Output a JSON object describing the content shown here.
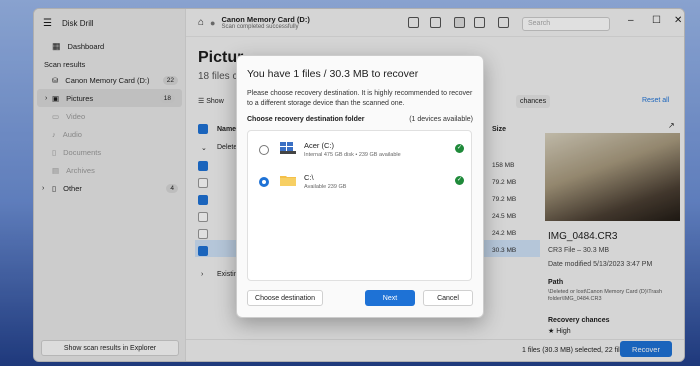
{
  "app": {
    "title": "Disk Drill"
  },
  "sidebar": {
    "dashboard": "Dashboard",
    "section": "Scan results",
    "items": [
      {
        "label": "Canon Memory Card (D:)",
        "count": "22"
      },
      {
        "label": "Pictures",
        "count": "18"
      },
      {
        "label": "Video",
        "count": ""
      },
      {
        "label": "Audio",
        "count": ""
      },
      {
        "label": "Documents",
        "count": ""
      },
      {
        "label": "Archives",
        "count": ""
      },
      {
        "label": "Other",
        "count": "4"
      }
    ],
    "footer_button": "Show scan results in Explorer"
  },
  "toolbar": {
    "title": "Canon Memory Card (D:)",
    "subtitle": "Scan completed successfully",
    "search_placeholder": "Search"
  },
  "main": {
    "page_title": "Pictur",
    "page_sub": "18 files c",
    "show_btn": "Show",
    "chances_btn": "chances",
    "reset_all": "Reset all",
    "col_name": "Name",
    "col_size": "Size",
    "group_deleted": "Delete",
    "group_existing": "Existin",
    "sizes": [
      "158 MB",
      "79.2 MB",
      "79.2 MB",
      "24.5 MB",
      "24.2 MB",
      "30.3 MB"
    ]
  },
  "preview": {
    "file_name": "IMG_0484.CR3",
    "file_type": "CR3 File – 30.3 MB",
    "modified": "Date modified 5/13/2023 3:47 PM",
    "path_label": "Path",
    "path_value": "\\Deleted or lost\\Canon Memory Card (D)\\Trash folder\\IMG_0484.CR3",
    "chances_label": "Recovery chances",
    "chances_value": "High"
  },
  "bottom": {
    "status": "1 files (30.3 MB) selected, 22 files total",
    "recover": "Recover"
  },
  "dialog": {
    "title": "You have 1 files / 30.3 MB to recover",
    "message": "Please choose recovery destination. It is highly recommended to recover to a different storage device than the scanned one.",
    "list_label": "Choose recovery destination folder",
    "devices_count": "(1 devices available)",
    "destinations": [
      {
        "name": "Acer (C:)",
        "detail": "Internal 475 GB disk • 239 GB available"
      },
      {
        "name": "C:\\",
        "detail": "Available 239 GB"
      }
    ],
    "choose_btn": "Choose destination",
    "next_btn": "Next",
    "cancel_btn": "Cancel"
  },
  "colors": {
    "accent": "#1e72d6",
    "success": "#1f8a3a"
  }
}
